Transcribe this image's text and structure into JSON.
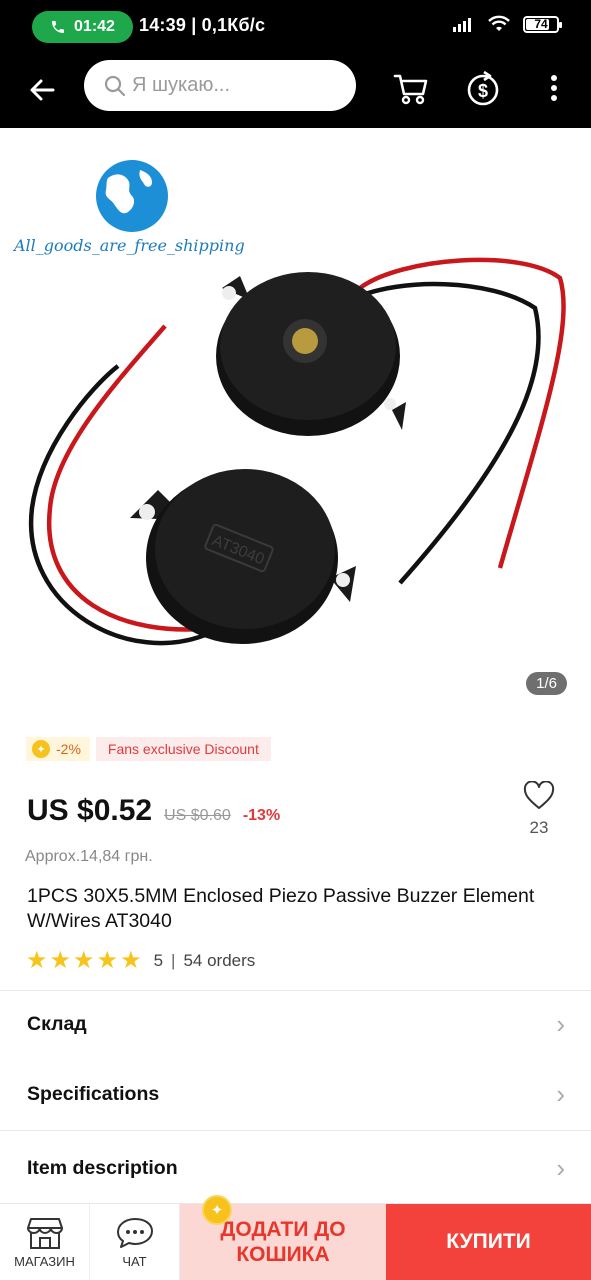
{
  "status_bar": {
    "call_time": "01:42",
    "time_speed": "14:39 | 0,1Кб/с",
    "battery": "74"
  },
  "top_bar": {
    "search_placeholder": "Я шукаю..."
  },
  "gallery": {
    "watermark": "All_goods_are_free_shipping",
    "component_marking": "AT3040",
    "page_indicator": "1/6"
  },
  "promo": {
    "coins_discount": "-2%",
    "fans_discount": "Fans exclusive Discount"
  },
  "product": {
    "price": "US $0.52",
    "old_price": "US $0.60",
    "discount": "-13%",
    "wishlist_count": "23",
    "approx_price": "Approx.14,84 грн.",
    "title": "1PCS 30X5.5MM Enclosed Piezo Passive Buzzer Element W/Wires AT3040",
    "rating": "5",
    "orders": "54 orders"
  },
  "sections": {
    "warehouse": "Склад",
    "specifications": "Specifications",
    "item_description": "Item description"
  },
  "bottom_bar": {
    "store_label": "МАГАЗИН",
    "chat_label": "ЧАТ",
    "add_to_cart": "ДОДАТИ ДО КОШИКА",
    "buy_now": "КУПИТИ"
  },
  "colors": {
    "accent_red": "#f2423b",
    "call_green": "#1fa84b",
    "star_yellow": "#f8c41c"
  }
}
